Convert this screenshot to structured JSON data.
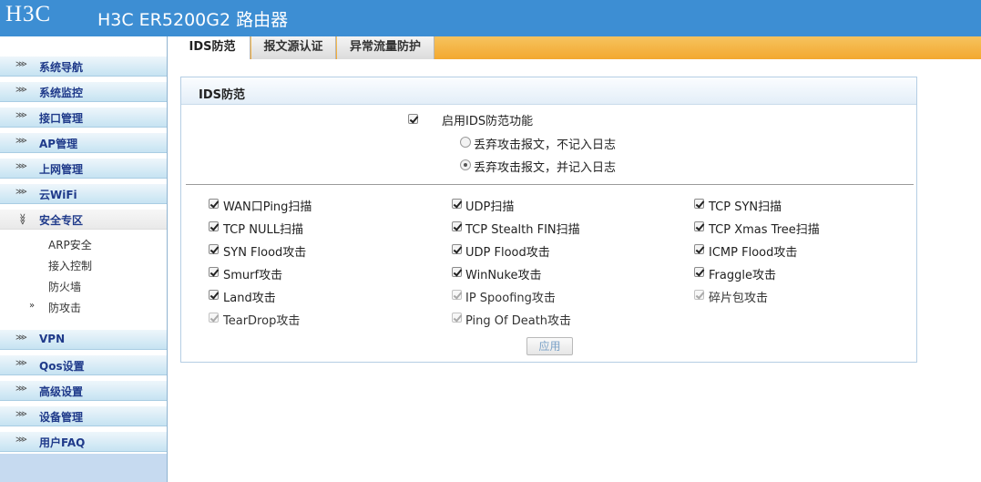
{
  "header": {
    "logo": "H3C",
    "title": "H3C ER5200G2 路由器"
  },
  "sidebar": {
    "items": [
      {
        "label": "系统导航"
      },
      {
        "label": "系统监控"
      },
      {
        "label": "接口管理"
      },
      {
        "label": "AP管理"
      },
      {
        "label": "上网管理"
      },
      {
        "label": "云WiFi"
      },
      {
        "label": "安全专区"
      },
      {
        "label": "VPN"
      },
      {
        "label": "Qos设置"
      },
      {
        "label": "高级设置"
      },
      {
        "label": "设备管理"
      },
      {
        "label": "用户FAQ"
      }
    ],
    "sub_items": [
      {
        "label": "ARP安全"
      },
      {
        "label": "接入控制"
      },
      {
        "label": "防火墙"
      },
      {
        "label": "防攻击"
      }
    ]
  },
  "tabs": [
    {
      "label": "IDS防范"
    },
    {
      "label": "报文源认证"
    },
    {
      "label": "异常流量防护"
    }
  ],
  "panel": {
    "title": "IDS防范",
    "enable_label": "启用IDS防范功能",
    "enable_checked": true,
    "radio_options": [
      {
        "label": "丢弃攻击报文，不记入日志",
        "selected": false
      },
      {
        "label": "丢弃攻击报文，并记入日志",
        "selected": true
      }
    ],
    "attacks": [
      {
        "label": "WAN口Ping扫描",
        "checked": true,
        "disabled": false
      },
      {
        "label": "UDP扫描",
        "checked": true,
        "disabled": false
      },
      {
        "label": "TCP SYN扫描",
        "checked": true,
        "disabled": false
      },
      {
        "label": "TCP NULL扫描",
        "checked": true,
        "disabled": false
      },
      {
        "label": "TCP Stealth FIN扫描",
        "checked": true,
        "disabled": false
      },
      {
        "label": "TCP Xmas Tree扫描",
        "checked": true,
        "disabled": false
      },
      {
        "label": "SYN Flood攻击",
        "checked": true,
        "disabled": false
      },
      {
        "label": "UDP Flood攻击",
        "checked": true,
        "disabled": false
      },
      {
        "label": "ICMP Flood攻击",
        "checked": true,
        "disabled": false
      },
      {
        "label": "Smurf攻击",
        "checked": true,
        "disabled": false
      },
      {
        "label": "WinNuke攻击",
        "checked": true,
        "disabled": false
      },
      {
        "label": "Fraggle攻击",
        "checked": true,
        "disabled": false
      },
      {
        "label": "Land攻击",
        "checked": true,
        "disabled": false
      },
      {
        "label": "IP Spoofing攻击",
        "checked": true,
        "disabled": true
      },
      {
        "label": "碎片包攻击",
        "checked": true,
        "disabled": true
      },
      {
        "label": "TearDrop攻击",
        "checked": true,
        "disabled": true
      },
      {
        "label": "Ping Of Death攻击",
        "checked": true,
        "disabled": true
      }
    ],
    "apply_label": "应用"
  }
}
